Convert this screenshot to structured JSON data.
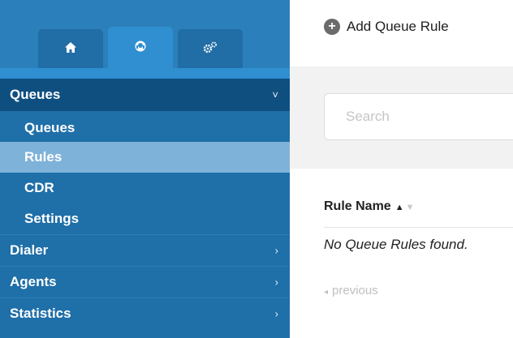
{
  "sidebar": {
    "tabs": [
      {
        "icon": "home-icon",
        "glyph": "🏠"
      },
      {
        "icon": "headset-agent-icon",
        "glyph": "◉"
      },
      {
        "icon": "gears-icon",
        "glyph": "⚙"
      }
    ],
    "queues_group": {
      "label": "Queues",
      "chevron": "˅",
      "items": [
        {
          "label": "Queues"
        },
        {
          "label": "Rules"
        },
        {
          "label": "CDR"
        },
        {
          "label": "Settings"
        }
      ]
    },
    "groups": [
      {
        "label": "Dialer",
        "chevron": "›"
      },
      {
        "label": "Agents",
        "chevron": "›"
      },
      {
        "label": "Statistics",
        "chevron": "›"
      }
    ]
  },
  "main": {
    "add_button": {
      "label": "Add Queue Rule",
      "icon_glyph": "+"
    },
    "search": {
      "placeholder": "Search"
    },
    "table": {
      "column": "Rule Name",
      "sort_up": "▲",
      "sort_down": "▼",
      "empty_message": "No Queue Rules found."
    },
    "pager": {
      "previous": "previous",
      "arrow": "◂"
    }
  },
  "colors": {
    "sidebar": "#1f6fa8",
    "group_header": "#0f4f80",
    "active_item": "#7fb2d8",
    "tab_active": "#2f8fd0"
  }
}
